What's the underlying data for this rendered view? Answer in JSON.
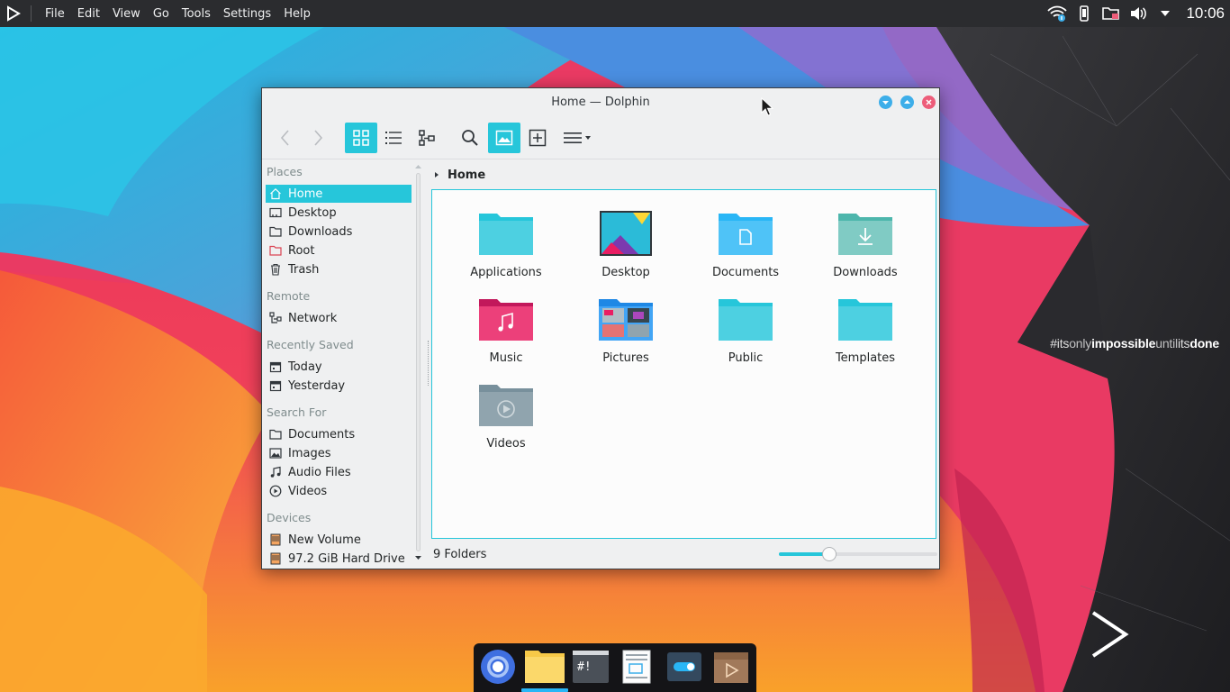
{
  "panel": {
    "menu": [
      "File",
      "Edit",
      "View",
      "Go",
      "Tools",
      "Settings",
      "Help"
    ],
    "clock": "10:06",
    "tray_icons": [
      "wifi-icon",
      "phone-icon",
      "folder-lock-icon",
      "volume-icon",
      "dropdown-arrow-icon"
    ]
  },
  "desktop": {
    "slogan": {
      "p1": "#its",
      "p2": "only",
      "p3": "impossible",
      "p4": "until",
      "p5": "its",
      "p6": "done"
    }
  },
  "window": {
    "title": "Home — Dolphin",
    "toolbar": [
      "back-icon",
      "forward-icon",
      "icons-view-icon",
      "details-view-icon",
      "split-view-icon",
      "search-icon",
      "preview-icon",
      "new-tab-icon",
      "hamburger-menu-icon"
    ],
    "sidebar": {
      "places_label": "Places",
      "places": [
        "Home",
        "Desktop",
        "Downloads",
        "Root",
        "Trash"
      ],
      "remote_label": "Remote",
      "remote": [
        "Network"
      ],
      "recent_label": "Recently Saved",
      "recent": [
        "Today",
        "Yesterday"
      ],
      "search_label": "Search For",
      "search": [
        "Documents",
        "Images",
        "Audio Files",
        "Videos"
      ],
      "devices_label": "Devices",
      "devices": [
        "New Volume",
        "97.2 GiB Hard Drive"
      ]
    },
    "breadcrumb": "Home",
    "folders": [
      "Applications",
      "Desktop",
      "Documents",
      "Downloads",
      "Music",
      "Pictures",
      "Public",
      "Templates",
      "Videos"
    ],
    "status": "9 Folders",
    "zoom_level": 0.3
  },
  "dock": {
    "apps": [
      "chromium-icon",
      "file-manager-icon",
      "terminal-icon",
      "text-editor-icon",
      "settings-toggle-icon",
      "media-player-icon"
    ]
  },
  "colors": {
    "accent": "#26c6da",
    "panel": "#2b2c2f",
    "close": "#ed5d7a",
    "window_button": "#3daee9"
  }
}
